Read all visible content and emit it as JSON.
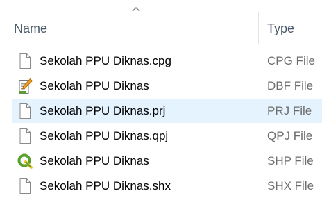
{
  "columns": {
    "name": "Name",
    "type": "Type"
  },
  "sort_indicator": "chevron-up-icon",
  "files": [
    {
      "name": "Sekolah PPU Diknas.cpg",
      "type": "CPG File",
      "icon": "document-icon",
      "selected": false
    },
    {
      "name": "Sekolah PPU Diknas",
      "type": "DBF File",
      "icon": "dbf-editor-icon",
      "selected": false
    },
    {
      "name": "Sekolah PPU Diknas.prj",
      "type": "PRJ File",
      "icon": "document-icon",
      "selected": true
    },
    {
      "name": "Sekolah PPU Diknas.qpj",
      "type": "QPJ File",
      "icon": "document-icon",
      "selected": false
    },
    {
      "name": "Sekolah PPU Diknas",
      "type": "SHP File",
      "icon": "qgis-icon",
      "selected": false
    },
    {
      "name": "Sekolah PPU Diknas.shx",
      "type": "SHX File",
      "icon": "document-icon",
      "selected": false
    }
  ],
  "colors": {
    "selection": "#e5f3ff",
    "header_text": "#4a5968",
    "type_text": "#6d6d6d",
    "qgis_green": "#5aa02c"
  }
}
